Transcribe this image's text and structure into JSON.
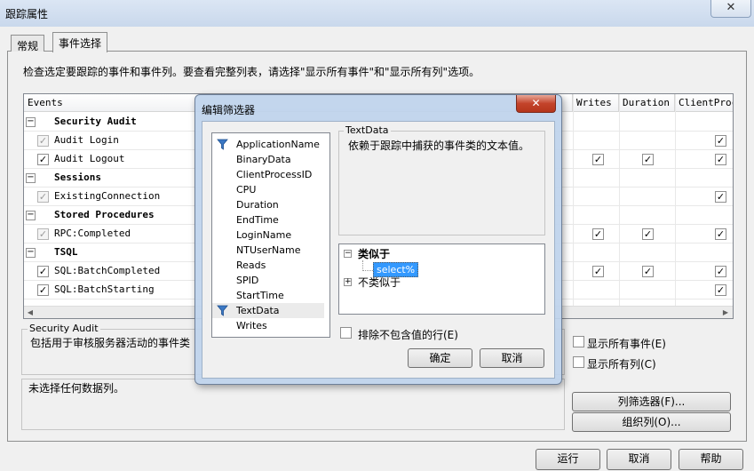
{
  "window": {
    "title": "跟踪属性",
    "close_glyph": "✕"
  },
  "tabs": [
    {
      "label": "常规"
    },
    {
      "label": "事件选择"
    }
  ],
  "description": "检查选定要跟踪的事件和事件列。要查看完整列表，请选择\"显示所有事件\"和\"显示所有列\"选项。",
  "grid": {
    "columns": [
      "Events",
      "Writes",
      "Duration",
      "ClientProc"
    ],
    "rows": [
      {
        "type": "category",
        "expander": "−",
        "label": "Security Audit"
      },
      {
        "type": "event",
        "label": "Audit Login",
        "checked": true,
        "disabled": true,
        "writes": false,
        "duration": false,
        "client": true
      },
      {
        "type": "event",
        "label": "Audit Logout",
        "checked": true,
        "disabled": false,
        "writes": true,
        "duration": true,
        "client": true
      },
      {
        "type": "category",
        "expander": "−",
        "label": "Sessions"
      },
      {
        "type": "event",
        "label": "ExistingConnection",
        "checked": true,
        "disabled": true,
        "writes": false,
        "duration": false,
        "client": true
      },
      {
        "type": "category",
        "expander": "−",
        "label": "Stored Procedures"
      },
      {
        "type": "event",
        "label": "RPC:Completed",
        "checked": true,
        "disabled": true,
        "writes": true,
        "duration": true,
        "client": true
      },
      {
        "type": "category",
        "expander": "−",
        "label": "TSQL"
      },
      {
        "type": "event",
        "label": "SQL:BatchCompleted",
        "checked": true,
        "disabled": false,
        "writes": true,
        "duration": true,
        "client": true
      },
      {
        "type": "event",
        "label": "SQL:BatchStarting",
        "checked": true,
        "disabled": false,
        "writes": false,
        "duration": false,
        "client": true
      }
    ],
    "check_glyph": "✓",
    "scroll_left": "◀",
    "scroll_right": "▶"
  },
  "event_info": {
    "group_label": "Security Audit",
    "text": "包括用于审核服务器活动的事件类"
  },
  "column_info": {
    "text": "未选择任何数据列。"
  },
  "options": {
    "show_all_events": {
      "label": "显示所有事件(E)",
      "checked": false
    },
    "show_all_columns": {
      "label": "显示所有列(C)",
      "checked": false
    }
  },
  "side_buttons": {
    "column_filters": "列筛选器(F)...",
    "organize_columns": "组织列(O)..."
  },
  "footer_buttons": {
    "run": "运行",
    "cancel": "取消",
    "help": "帮助"
  },
  "filter_dialog": {
    "title": "编辑筛选器",
    "columns": [
      "ApplicationName",
      "BinaryData",
      "ClientProcessID",
      "CPU",
      "Duration",
      "EndTime",
      "LoginName",
      "NTUserName",
      "Reads",
      "SPID",
      "StartTime",
      "TextData",
      "Writes"
    ],
    "filtered_columns": [
      "ApplicationName",
      "TextData"
    ],
    "selected_column": "TextData",
    "description_group": "TextData",
    "description_text": "依赖于跟踪中捕获的事件类的文本值。",
    "tree": {
      "like": {
        "label": "类似于",
        "expander": "−",
        "values": [
          "select%"
        ]
      },
      "not_like": {
        "label": "不类似于",
        "expander": "+"
      }
    },
    "exclude_rows": {
      "label": "排除不包含值的行(E)",
      "checked": false
    },
    "ok": "确定",
    "cancel": "取消"
  },
  "colors": {
    "accent_selection": "#3399ff",
    "dialog_frame": "#bed2eb"
  }
}
